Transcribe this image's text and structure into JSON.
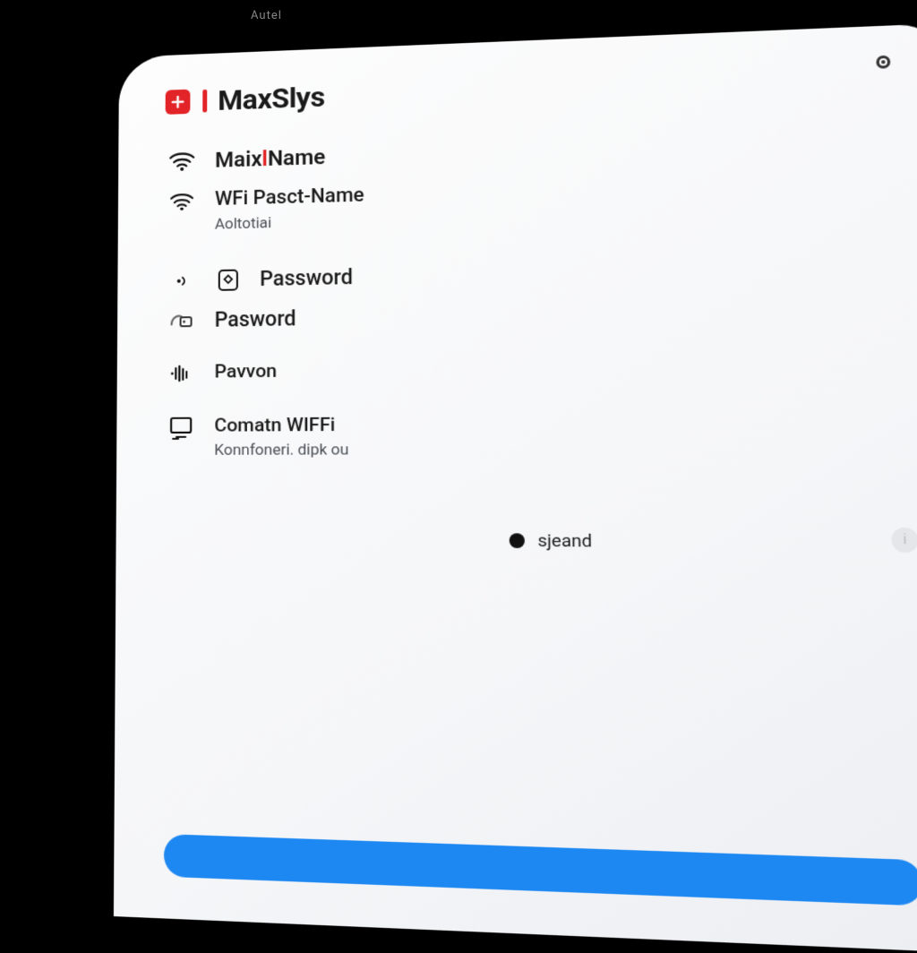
{
  "statusbar": {
    "text": "Autel"
  },
  "header": {
    "title": "MaxSlys",
    "icon": "plus-icon"
  },
  "menu": {
    "network_name": {
      "label_prefix": "Maix",
      "label_suffix": "Name"
    },
    "wifi_password": {
      "label": "WFi Pasct-Name",
      "sub": "Aoltotiai"
    },
    "password1": {
      "label": "Password"
    },
    "password2": {
      "label": "Pasword"
    },
    "pavon": {
      "label": "Pavvon"
    },
    "connect": {
      "label": "Comatn WIFFi",
      "sub": "Konnfoneri. dipk ou"
    }
  },
  "radio": {
    "label": "sjeand"
  },
  "button": {
    "label": ""
  },
  "info": {
    "glyph": "i"
  },
  "colors": {
    "accent": "#e22428",
    "primary": "#1e88f2"
  }
}
